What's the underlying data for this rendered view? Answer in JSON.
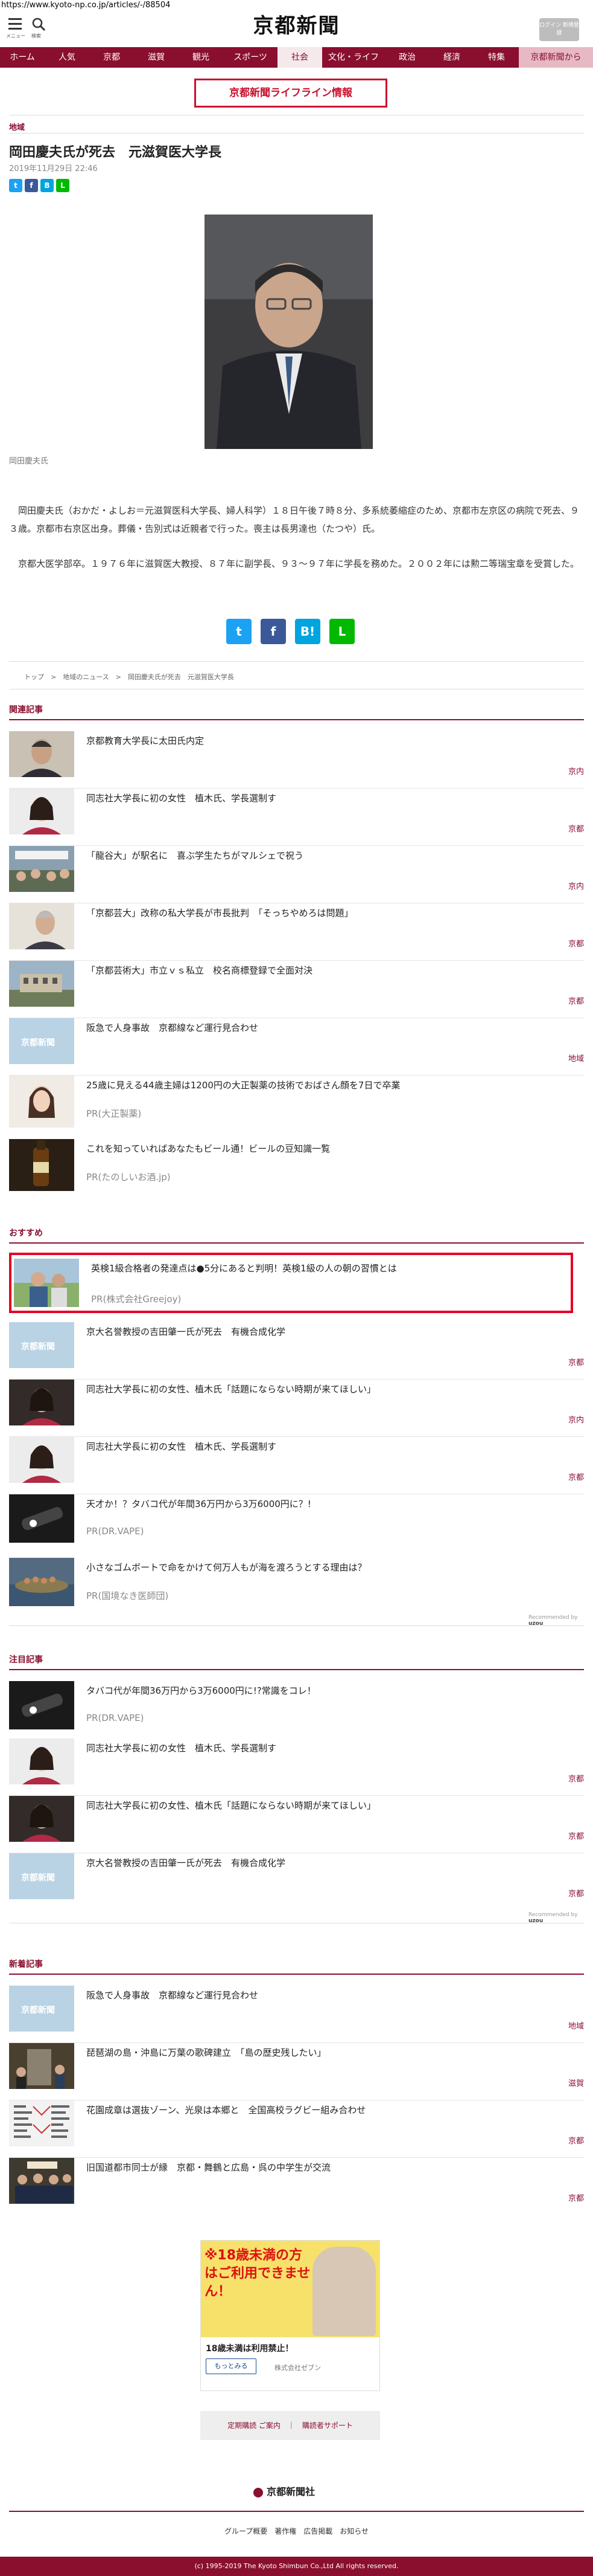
{
  "browser": {
    "url": "https://www.kyoto-np.co.jp/articles/-/88504"
  },
  "header": {
    "menu_label": "メニュー",
    "search_label": "検索",
    "logo": "京都新聞",
    "login_label": "ログイン 新規登録",
    "nav": [
      "ホーム",
      "人気",
      "京都",
      "滋賀",
      "観光",
      "スポーツ",
      "社会",
      "文化・ライフ",
      "政治",
      "経済",
      "特集",
      "京都新聞から"
    ]
  },
  "lifeline": "京都新聞ライフライン情報",
  "article": {
    "category": "地域",
    "title": "岡田慶夫氏が死去　元滋賀医大学長",
    "date": "2019年11月29日 22:46",
    "photo_caption": "岡田慶夫氏",
    "paragraphs": [
      "岡田慶夫氏（おかだ・よしお＝元滋賀医科大学長、婦人科学）１８日午後７時８分、多系統萎縮症のため、京都市左京区の病院で死去、９３歳。京都市右京区出身。葬儀・告別式は近親者で行った。喪主は長男達也（たつや）氏。",
      "京都大医学部卒。１９７６年に滋賀医大教授、８７年に副学長、９３～９７年に学長を務めた。２００２年には勲二等瑞宝章を受賞した。"
    ],
    "breadcrumb": "トップ　>　地域のニュース　>　岡田慶夫氏が死去　元滋賀医大学長",
    "share_small": [
      "twitter-icon",
      "facebook-icon",
      "hatena-icon",
      "line-icon"
    ],
    "share_large": [
      "twitter-icon",
      "facebook-icon",
      "hatena-icon",
      "line-icon"
    ]
  },
  "related": {
    "heading": "関連記事",
    "items": [
      {
        "text": "京都教育大学長に太田氏内定",
        "cat": "京内"
      },
      {
        "text": "同志社大学長に初の女性　植木氏、学長選制す",
        "cat": "京都"
      },
      {
        "text": "「龍谷大」が駅名に　喜ぶ学生たちがマルシェで祝う",
        "cat": "京内"
      },
      {
        "text": "「京都芸大」改称の私大学長が市長批判　「そっちやめろは問題」",
        "cat": "京都"
      },
      {
        "text": "「京都芸術大」市立ｖｓ私立　校名商標登録で全面対決",
        "cat": "京都"
      },
      {
        "text": "阪急で人身事故　京都線など運行見合わせ",
        "cat": "地域"
      },
      {
        "text": "25歳に見える44歳主婦は1200円の大正製薬の技術でおばさん顔を7日で卒業",
        "sub": "PR(大正製薬)"
      },
      {
        "text": "これを知っていればあなたもビール通！ビールの豆知識一覧",
        "sub": "PR(たのしいお酒.jp)"
      }
    ]
  },
  "recommend": {
    "heading": "おすすめ",
    "items": [
      {
        "text": "英検1級合格者の発達点は●5分にあると判明！英検1級の人の朝の習慣とは",
        "sub": "PR(株式会社Greejoy)"
      },
      {
        "text": "京大名誉教授の吉田肇一氏が死去　有機合成化学",
        "cat": "京都"
      },
      {
        "text": "同志社大学長に初の女性、植木氏「話題にならない時期が来てほしい」",
        "cat": "京内"
      },
      {
        "text": "同志社大学長に初の女性　植木氏、学長選制す",
        "cat": "京都"
      },
      {
        "text": "天才か！？タバコ代が年間36万円から3万6000円に？!",
        "sub": "PR(DR.VAPE)"
      },
      {
        "text": "小さなゴムボートで命をかけて何万人もが海を渡ろうとする理由は？",
        "sub": "PR(国境なき医師団)"
      }
    ],
    "credit": "Recommended by"
  },
  "featured": {
    "heading": "注目記事",
    "items": [
      {
        "text": "タバコ代が年間36万円から3万6000円に!?常識をコレ！",
        "sub": "PR(DR.VAPE)"
      },
      {
        "text": "同志社大学長に初の女性　植木氏、学長選制す",
        "cat": "京都"
      },
      {
        "text": "同志社大学長に初の女性、植木氏「話題にならない時期が来てほしい」",
        "cat": "京都"
      },
      {
        "text": "京大名誉教授の吉田肇一氏が死去　有機合成化学",
        "cat": "京都"
      }
    ],
    "credit": "Recommended by"
  },
  "latest": {
    "heading": "新着記事",
    "items": [
      {
        "text": "阪急で人身事故　京都線など運行見合わせ",
        "cat": "地域"
      },
      {
        "text": "琵琶湖の島・沖島に万葉の歌碑建立　「島の歴史残したい」",
        "cat": "滋賀"
      },
      {
        "text": "花園成章は選抜ゾーン、光泉は本郷と　全国高校ラグビー組み合わせ",
        "cat": "京都"
      },
      {
        "text": "旧国道都市同士が縁　京都・舞鶴と広島・呉の中学生が交流",
        "cat": "京都"
      }
    ]
  },
  "ad": {
    "headline": "※18歳未満の方はご利用できません！",
    "title": "18歳未満は利用禁止！",
    "button": "もっとみる",
    "sponsor": "株式会社ゼブン"
  },
  "bottom_links": "定期購読 ご案内　｜　購読者サポート",
  "footer": {
    "logo": "京都新聞社",
    "links": "グループ概要　著作権　広告掲載　お知らせ",
    "copyright": "(c) 1995-2019 The Kyoto Shimbun Co.,Ltd All rights reserved."
  },
  "colors": {
    "brand": "#8a0f2f",
    "alert": "#c8102e",
    "highlight": "#e60023"
  }
}
